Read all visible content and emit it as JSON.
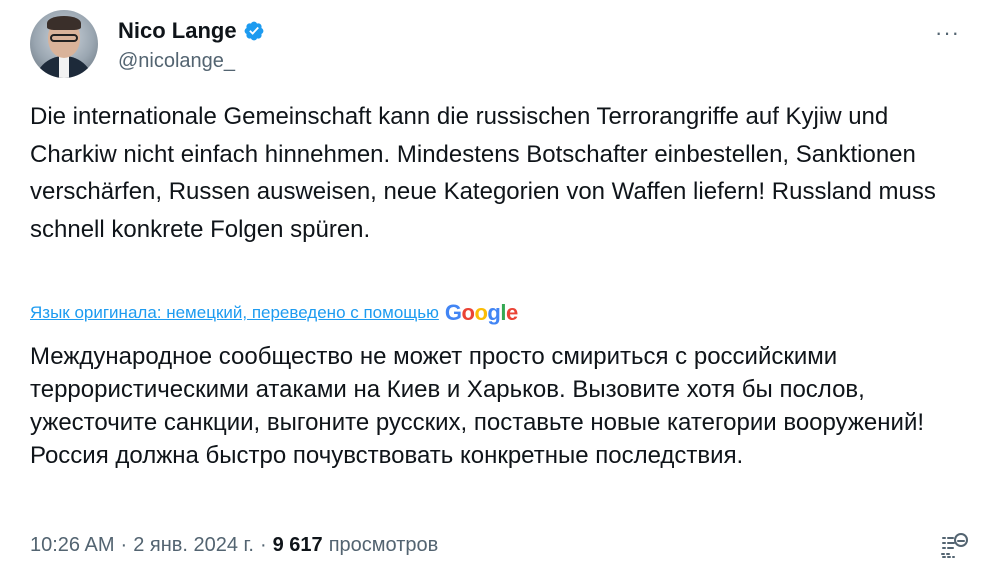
{
  "author": {
    "name": "Nico Lange",
    "handle": "@nicolange_",
    "verified": true
  },
  "more_menu": {
    "label": "···"
  },
  "tweet": {
    "text": "Die internationale Gemeinschaft kann die russischen Terrorangriffe auf Kyjiw und Charkiw nicht einfach hinnehmen. Mindestens Botschafter einbestellen, Sanktionen verschärfen, Russen ausweisen, neue Kategorien von Waffen liefern! Russland muss schnell konkrete Folgen spüren."
  },
  "translation": {
    "notice": "Язык оригинала: немецкий, переведено с помощью",
    "provider": "Google",
    "text": "Международное сообщество не может просто смириться с российскими террористическими атаками на Киев и Харьков. Вызовите хотя бы послов, ужесточите санкции, выгоните русских, поставьте новые категории вооружений! Россия должна быстро почувствовать конкретные последствия."
  },
  "meta": {
    "time": "10:26 AM",
    "date": "2 янв. 2024 г.",
    "sep": "·",
    "views_count": "9 617",
    "views_label": "просмотров"
  },
  "colors": {
    "accent": "#1d9bf0",
    "text": "#0f1419",
    "secondary": "#536471"
  },
  "icons": {
    "verified": "verified-badge-icon",
    "more": "more-horizontal-icon",
    "stats": "post-analytics-icon"
  }
}
